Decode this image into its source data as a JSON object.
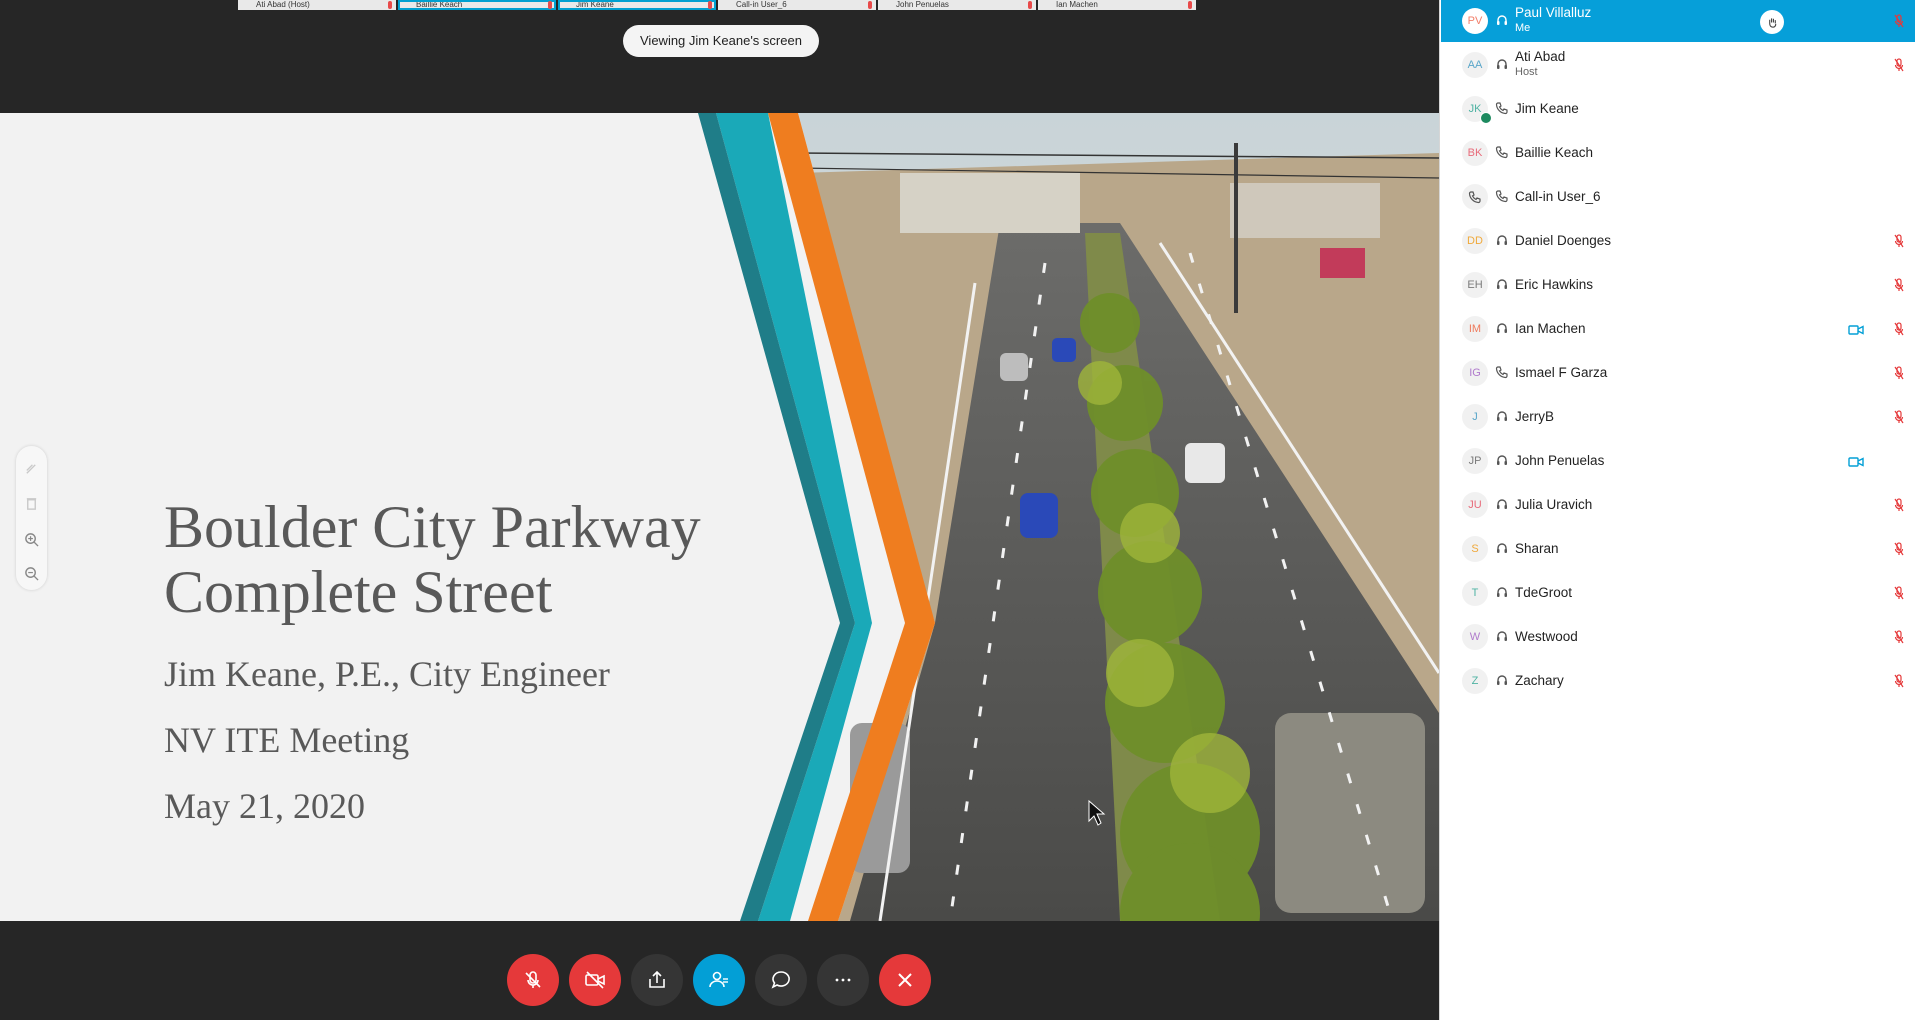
{
  "filmstrip": [
    {
      "label": "Ati Abad (Host)",
      "active": false
    },
    {
      "label": "Baillie Keach",
      "active": true
    },
    {
      "label": "Jim Keane",
      "active": true
    },
    {
      "label": "Call-in User_6",
      "active": false
    },
    {
      "label": "John Penuelas",
      "active": false
    },
    {
      "label": "Ian Machen",
      "active": false
    }
  ],
  "viewing_banner": "Viewing Jim Keane's screen",
  "slide": {
    "title_line1": "Boulder City Parkway",
    "title_line2": "Complete Street",
    "author": "Jim Keane, P.E., City Engineer",
    "meeting": "NV ITE Meeting",
    "date": "May 21, 2020",
    "accent_teal": "#1aa9b8",
    "accent_orange": "#ef7d1f"
  },
  "zoom_tools": [
    "annotate-icon",
    "clear-icon",
    "zoom-in-icon",
    "zoom-out-icon"
  ],
  "controls": [
    {
      "name": "mute-button",
      "icon": "mic-muted-icon",
      "style": "red"
    },
    {
      "name": "stop-video-button",
      "icon": "video-off-icon",
      "style": "red"
    },
    {
      "name": "share-button",
      "icon": "share-icon",
      "style": "dark"
    },
    {
      "name": "participants-button",
      "icon": "participants-icon",
      "style": "blue"
    },
    {
      "name": "chat-button",
      "icon": "chat-icon",
      "style": "dark"
    },
    {
      "name": "more-button",
      "icon": "more-icon",
      "style": "dark"
    },
    {
      "name": "leave-button",
      "icon": "close-icon",
      "style": "red"
    }
  ],
  "participants": [
    {
      "initials": "PV",
      "name": "Paul Villalluz",
      "sub": "Me",
      "conn": "audio",
      "muted": true,
      "video": false,
      "me": true,
      "color": "#f27f6a"
    },
    {
      "initials": "AA",
      "name": "Ati Abad",
      "sub": "Host",
      "conn": "audio",
      "muted": true,
      "video": false,
      "color": "#5aa6c9"
    },
    {
      "initials": "JK",
      "name": "Jim Keane",
      "sub": "",
      "conn": "phone",
      "muted": false,
      "video": false,
      "color": "#4fb3a3",
      "presenting": true
    },
    {
      "initials": "BK",
      "name": "Baillie Keach",
      "sub": "",
      "conn": "phone",
      "muted": false,
      "video": false,
      "color": "#e86b7a"
    },
    {
      "initials": "",
      "name": "Call-in User_6",
      "sub": "",
      "conn": "phone",
      "muted": false,
      "video": false,
      "color": "#666666",
      "phone_avatar": true
    },
    {
      "initials": "DD",
      "name": "Daniel Doenges",
      "sub": "",
      "conn": "audio",
      "muted": true,
      "video": false,
      "color": "#f0a93b"
    },
    {
      "initials": "EH",
      "name": "Eric Hawkins",
      "sub": "",
      "conn": "audio",
      "muted": true,
      "video": false,
      "color": "#7b7b7b"
    },
    {
      "initials": "IM",
      "name": "Ian Machen",
      "sub": "",
      "conn": "audio",
      "muted": true,
      "video": true,
      "color": "#ef7a5c"
    },
    {
      "initials": "IG",
      "name": "Ismael F Garza",
      "sub": "",
      "conn": "phone",
      "muted": true,
      "video": false,
      "color": "#b07bcc"
    },
    {
      "initials": "J",
      "name": "JerryB",
      "sub": "",
      "conn": "audio",
      "muted": true,
      "video": false,
      "color": "#5aa6c9"
    },
    {
      "initials": "JP",
      "name": "John Penuelas",
      "sub": "",
      "conn": "audio",
      "muted": false,
      "video": true,
      "color": "#7b7b7b"
    },
    {
      "initials": "JU",
      "name": "Julia Uravich",
      "sub": "",
      "conn": "audio",
      "muted": true,
      "video": false,
      "color": "#e86b7a"
    },
    {
      "initials": "S",
      "name": "Sharan",
      "sub": "",
      "conn": "audio",
      "muted": true,
      "video": false,
      "color": "#f0a93b"
    },
    {
      "initials": "T",
      "name": "TdeGroot",
      "sub": "",
      "conn": "audio",
      "muted": true,
      "video": false,
      "color": "#4fb3a3"
    },
    {
      "initials": "W",
      "name": "Westwood",
      "sub": "",
      "conn": "audio",
      "muted": true,
      "video": false,
      "color": "#b07bcc"
    },
    {
      "initials": "Z",
      "name": "Zachary",
      "sub": "",
      "conn": "audio",
      "muted": true,
      "video": false,
      "color": "#4fb3a3"
    }
  ]
}
